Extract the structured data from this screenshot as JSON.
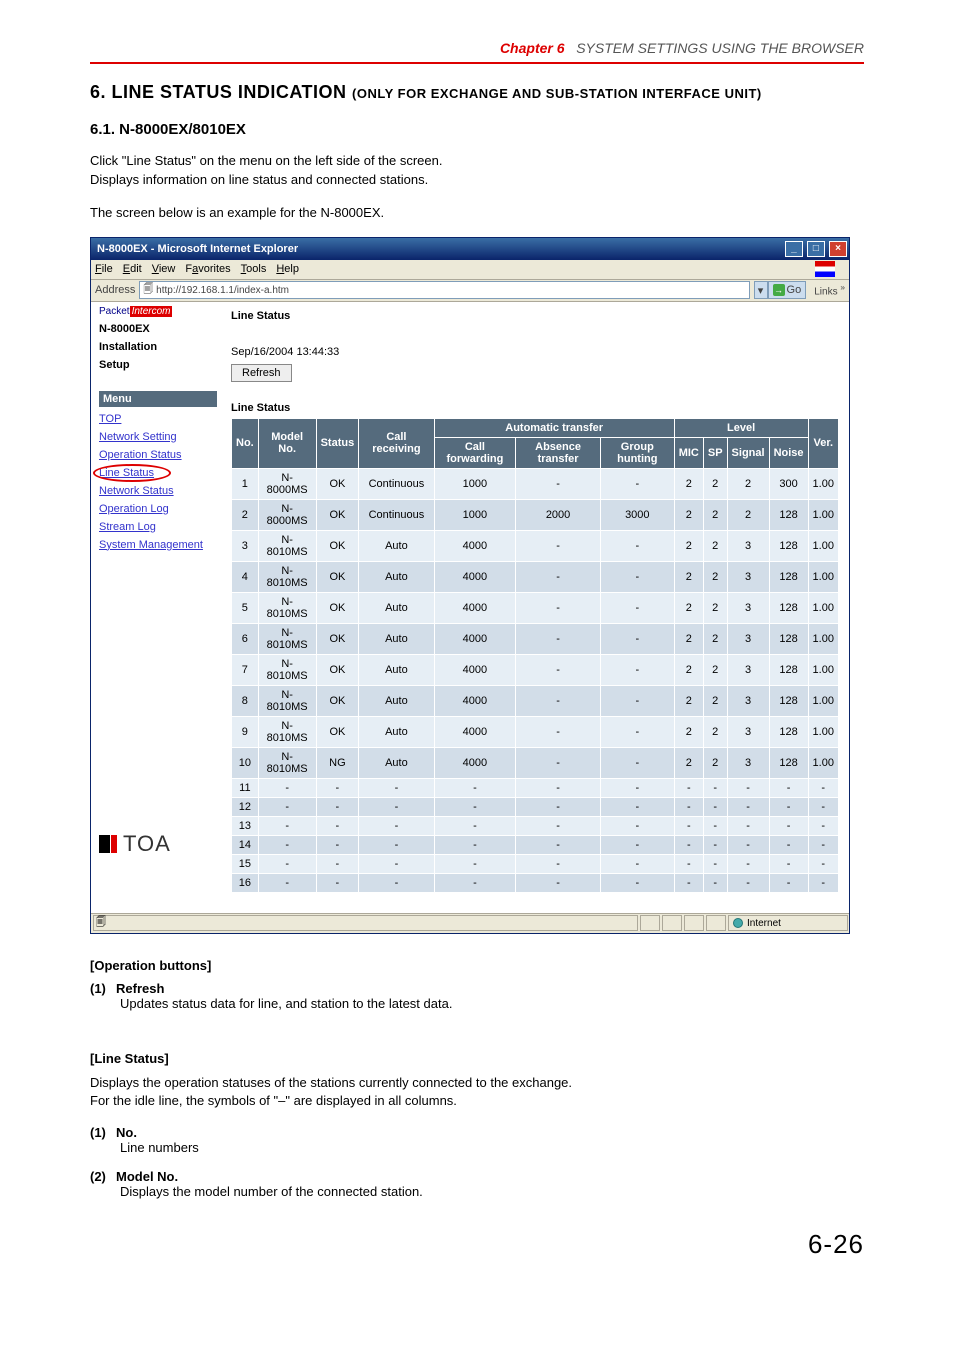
{
  "chapter": {
    "label": "Chapter 6",
    "title": "SYSTEM SETTINGS USING THE BROWSER"
  },
  "heading": {
    "num": "6. LINE STATUS INDICATION",
    "sub": "(ONLY FOR EXCHANGE AND SUB-STATION INTERFACE UNIT)"
  },
  "sub_heading": "6.1. N-8000EX/8010EX",
  "intro1": "Click \"Line Status\" on the menu on the left side of the screen.",
  "intro2": "Displays information on line status and connected stations.",
  "intro3": "The screen below is an example for the N-8000EX.",
  "browser": {
    "title": "N-8000EX - Microsoft Internet Explorer",
    "menubar": [
      "File",
      "Edit",
      "View",
      "Favorites",
      "Tools",
      "Help"
    ],
    "address_label": "Address",
    "address_url": "http://192.168.1.1/index-a.htm",
    "go_label": "Go",
    "links_label": "Links",
    "status_internet": "Internet"
  },
  "sidebar": {
    "logo_packet": "Packet",
    "logo_intercom": "Intercom",
    "device": "N-8000EX",
    "install": "Installation",
    "setup": "Setup",
    "menu_label": "Menu",
    "items": [
      "TOP",
      "Network Setting",
      "Operation Status",
      "Line Status",
      "Network Status",
      "Operation Log",
      "Stream Log",
      "System Management"
    ],
    "toa": "TOA"
  },
  "main": {
    "title": "Line Status",
    "timestamp": "Sep/16/2004 13:44:33",
    "refresh": "Refresh",
    "section_label": "Line Status",
    "columns": {
      "no": "No.",
      "model": "Model No.",
      "status": "Status",
      "callrec": "Call receiving",
      "auto_group": "Automatic transfer",
      "callfwd": "Call forwarding",
      "absence": "Absence transfer",
      "group": "Group hunting",
      "level_group": "Level",
      "mic": "MIC",
      "sp": "SP",
      "signal": "Signal",
      "noise": "Noise",
      "ver": "Ver."
    },
    "rows": [
      {
        "no": "1",
        "model": "N-8000MS",
        "status": "OK",
        "callrec": "Continuous",
        "cf": "1000",
        "ab": "-",
        "gh": "-",
        "mic": "2",
        "sp": "2",
        "sig": "2",
        "noise": "300",
        "ver": "1.00"
      },
      {
        "no": "2",
        "model": "N-8000MS",
        "status": "OK",
        "callrec": "Continuous",
        "cf": "1000",
        "ab": "2000",
        "gh": "3000",
        "mic": "2",
        "sp": "2",
        "sig": "2",
        "noise": "128",
        "ver": "1.00"
      },
      {
        "no": "3",
        "model": "N-8010MS",
        "status": "OK",
        "callrec": "Auto",
        "cf": "4000",
        "ab": "-",
        "gh": "-",
        "mic": "2",
        "sp": "2",
        "sig": "3",
        "noise": "128",
        "ver": "1.00"
      },
      {
        "no": "4",
        "model": "N-8010MS",
        "status": "OK",
        "callrec": "Auto",
        "cf": "4000",
        "ab": "-",
        "gh": "-",
        "mic": "2",
        "sp": "2",
        "sig": "3",
        "noise": "128",
        "ver": "1.00"
      },
      {
        "no": "5",
        "model": "N-8010MS",
        "status": "OK",
        "callrec": "Auto",
        "cf": "4000",
        "ab": "-",
        "gh": "-",
        "mic": "2",
        "sp": "2",
        "sig": "3",
        "noise": "128",
        "ver": "1.00"
      },
      {
        "no": "6",
        "model": "N-8010MS",
        "status": "OK",
        "callrec": "Auto",
        "cf": "4000",
        "ab": "-",
        "gh": "-",
        "mic": "2",
        "sp": "2",
        "sig": "3",
        "noise": "128",
        "ver": "1.00"
      },
      {
        "no": "7",
        "model": "N-8010MS",
        "status": "OK",
        "callrec": "Auto",
        "cf": "4000",
        "ab": "-",
        "gh": "-",
        "mic": "2",
        "sp": "2",
        "sig": "3",
        "noise": "128",
        "ver": "1.00"
      },
      {
        "no": "8",
        "model": "N-8010MS",
        "status": "OK",
        "callrec": "Auto",
        "cf": "4000",
        "ab": "-",
        "gh": "-",
        "mic": "2",
        "sp": "2",
        "sig": "3",
        "noise": "128",
        "ver": "1.00"
      },
      {
        "no": "9",
        "model": "N-8010MS",
        "status": "OK",
        "callrec": "Auto",
        "cf": "4000",
        "ab": "-",
        "gh": "-",
        "mic": "2",
        "sp": "2",
        "sig": "3",
        "noise": "128",
        "ver": "1.00"
      },
      {
        "no": "10",
        "model": "N-8010MS",
        "status": "NG",
        "callrec": "Auto",
        "cf": "4000",
        "ab": "-",
        "gh": "-",
        "mic": "2",
        "sp": "2",
        "sig": "3",
        "noise": "128",
        "ver": "1.00"
      },
      {
        "no": "11",
        "model": "-",
        "status": "-",
        "callrec": "-",
        "cf": "-",
        "ab": "-",
        "gh": "-",
        "mic": "-",
        "sp": "-",
        "sig": "-",
        "noise": "-",
        "ver": "-"
      },
      {
        "no": "12",
        "model": "-",
        "status": "-",
        "callrec": "-",
        "cf": "-",
        "ab": "-",
        "gh": "-",
        "mic": "-",
        "sp": "-",
        "sig": "-",
        "noise": "-",
        "ver": "-"
      },
      {
        "no": "13",
        "model": "-",
        "status": "-",
        "callrec": "-",
        "cf": "-",
        "ab": "-",
        "gh": "-",
        "mic": "-",
        "sp": "-",
        "sig": "-",
        "noise": "-",
        "ver": "-"
      },
      {
        "no": "14",
        "model": "-",
        "status": "-",
        "callrec": "-",
        "cf": "-",
        "ab": "-",
        "gh": "-",
        "mic": "-",
        "sp": "-",
        "sig": "-",
        "noise": "-",
        "ver": "-"
      },
      {
        "no": "15",
        "model": "-",
        "status": "-",
        "callrec": "-",
        "cf": "-",
        "ab": "-",
        "gh": "-",
        "mic": "-",
        "sp": "-",
        "sig": "-",
        "noise": "-",
        "ver": "-"
      },
      {
        "no": "16",
        "model": "-",
        "status": "-",
        "callrec": "-",
        "cf": "-",
        "ab": "-",
        "gh": "-",
        "mic": "-",
        "sp": "-",
        "sig": "-",
        "noise": "-",
        "ver": "-"
      }
    ]
  },
  "explanations": {
    "op_buttons_hdr": "[Operation buttons]",
    "refresh_num": "(1)",
    "refresh_lbl": "Refresh",
    "refresh_desc": "Updates status data for line, and station to the latest data.",
    "line_status_hdr": "[Line Status]",
    "line_status_desc1": "Displays the operation statuses of the stations currently connected to the exchange.",
    "line_status_desc2": "For the idle line, the symbols of \"–\" are displayed in all columns.",
    "no_num": "(1)",
    "no_lbl": "No.",
    "no_desc": "Line numbers",
    "model_num": "(2)",
    "model_lbl": "Model No.",
    "model_desc": "Displays the model number of the connected station."
  },
  "page_number": "6-26"
}
